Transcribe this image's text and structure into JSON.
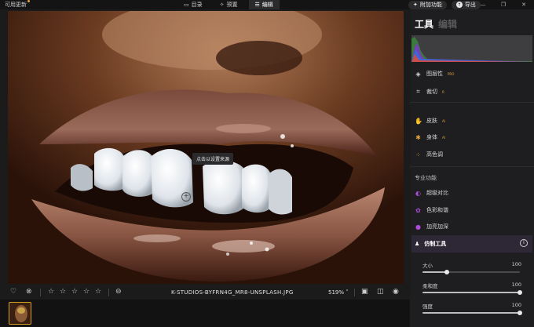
{
  "topbar": {
    "update_label": "可用更新",
    "tabs": [
      {
        "label": "目录",
        "icon": "folder-icon"
      },
      {
        "label": "预置",
        "icon": "presets-icon"
      },
      {
        "label": "编辑",
        "icon": "sliders-icon",
        "active": true
      }
    ],
    "addons_label": "附加功能",
    "export_label": "导出"
  },
  "canvas": {
    "tooltip": "点击以设置来源"
  },
  "bottombar": {
    "filename": "K-STUDIOS-BYFRN4G_MR8-UNSPLASH.JPG",
    "zoom": "519% ˅",
    "rating_stars": 0
  },
  "panel": {
    "tab_tools": "工具",
    "tab_edit": "编辑",
    "tools": [
      {
        "label": "图层性",
        "badge": "PRO",
        "icon": "layers-icon"
      },
      {
        "label": "裁切",
        "badge": "R",
        "icon": "crop-icon"
      },
      {
        "label": "皮肤",
        "badge": "AI",
        "icon": "hand-icon"
      },
      {
        "label": "身体",
        "badge": "AI",
        "icon": "body-icon"
      },
      {
        "label": "高色调",
        "badge": "",
        "icon": "dots-icon"
      }
    ],
    "pro_section": "专业功能",
    "pro_tools": [
      {
        "label": "超级对比",
        "icon": "contrast-icon"
      },
      {
        "label": "色彩和谐",
        "icon": "flower-icon"
      },
      {
        "label": "加亮加深",
        "icon": "drop-icon"
      }
    ],
    "active_tool": "仿制工具",
    "sliders": [
      {
        "label": "大小",
        "value": "100",
        "fraction": 0.25
      },
      {
        "label": "柔和度",
        "value": "100",
        "fraction": 1.0
      },
      {
        "label": "强度",
        "value": "100",
        "fraction": 1.0
      }
    ]
  },
  "colors": {
    "accent": "#e3a43c",
    "active_tool_bg": "#2e2836",
    "panel_bg": "#1e1e20"
  }
}
